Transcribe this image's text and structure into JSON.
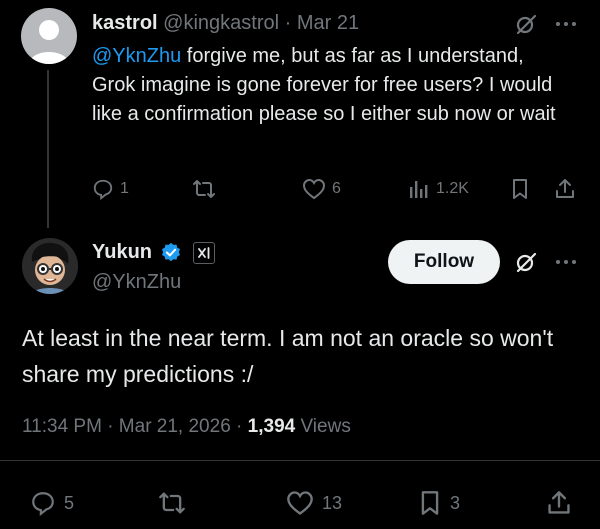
{
  "parent": {
    "display_name": "kastrol",
    "handle": "@kingkastrol",
    "separator": "·",
    "date": "Mar 21",
    "mention": "@YknZhu",
    "text": " forgive me, but as far as I understand, Grok imagine is gone forever for free users? I would like a confirmation please so I either sub now or wait",
    "replies": "1",
    "likes": "6",
    "views": "1.2K"
  },
  "reply": {
    "display_name": "Yukun",
    "handle": "@YknZhu",
    "follow_label": "Follow",
    "text": "At least in the near term. I am not an oracle so won't share my predictions :/",
    "timestamp": "11:34 PM · Mar 21, 2026 · ",
    "views_count": "1,394",
    "views_label": " Views",
    "replies": "5",
    "likes": "13",
    "bookmarks": "3"
  },
  "icons": [
    "avatar-default",
    "grok-icon",
    "more-icon",
    "reply-icon",
    "retweet-icon",
    "like-icon",
    "views-icon",
    "bookmark-icon",
    "share-icon",
    "verified-badge-icon",
    "xai-affiliate-icon"
  ],
  "colors": {
    "background": "#000000",
    "text": "#e7e9ea",
    "secondary": "#71767b",
    "link": "#1d9bf0",
    "verified": "#1d9bf0",
    "follow_bg": "#eff3f4"
  }
}
